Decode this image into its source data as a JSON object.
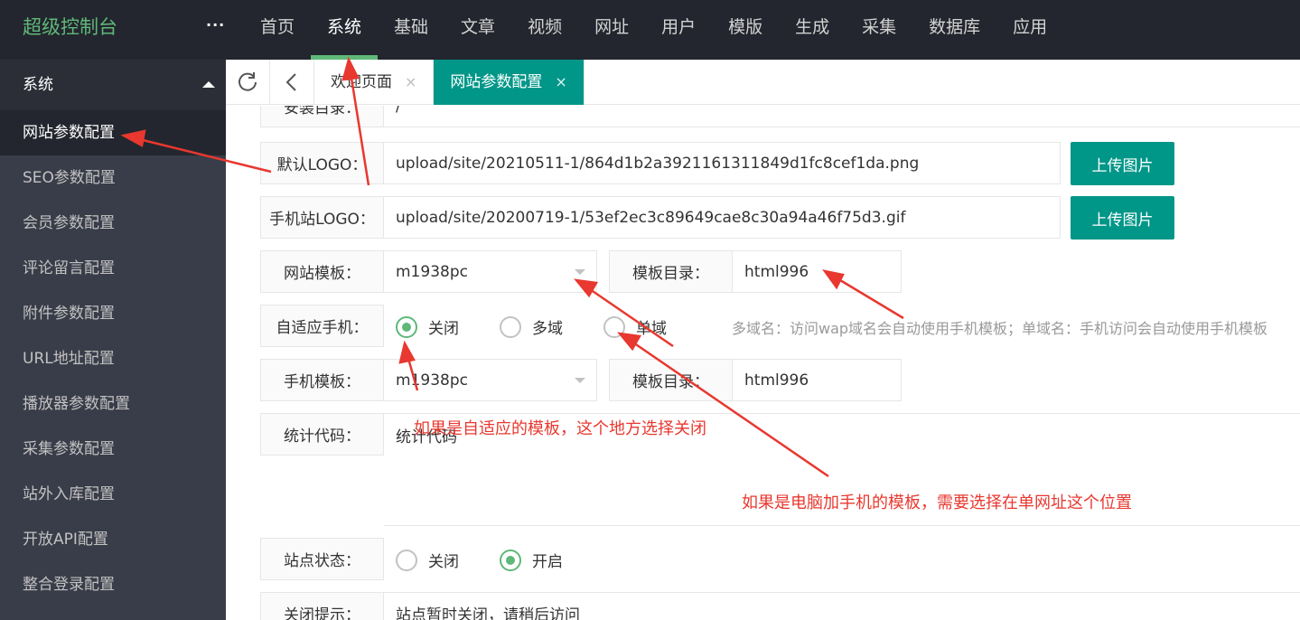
{
  "app": {
    "title": "超级控制台",
    "more_label": "···"
  },
  "nav": [
    {
      "label": "首页"
    },
    {
      "label": "系统"
    },
    {
      "label": "基础"
    },
    {
      "label": "文章"
    },
    {
      "label": "视频"
    },
    {
      "label": "网址"
    },
    {
      "label": "用户"
    },
    {
      "label": "模版"
    },
    {
      "label": "生成"
    },
    {
      "label": "采集"
    },
    {
      "label": "数据库"
    },
    {
      "label": "应用"
    }
  ],
  "sidebar": {
    "header": "系统",
    "items": [
      {
        "label": "网站参数配置"
      },
      {
        "label": "SEO参数配置"
      },
      {
        "label": "会员参数配置"
      },
      {
        "label": "评论留言配置"
      },
      {
        "label": "附件参数配置"
      },
      {
        "label": "URL地址配置"
      },
      {
        "label": "播放器参数配置"
      },
      {
        "label": "采集参数配置"
      },
      {
        "label": "站外入库配置"
      },
      {
        "label": "开放API配置"
      },
      {
        "label": "整合登录配置"
      }
    ]
  },
  "tabs": [
    {
      "label": "欢迎页面",
      "close": "×"
    },
    {
      "label": "网站参数配置",
      "close": "×"
    }
  ],
  "form": {
    "install_dir": {
      "label": "安装目录：",
      "value": "/"
    },
    "default_logo": {
      "label": "默认LOGO：",
      "value": "upload/site/20210511-1/864d1b2a3921161311849d1fc8cef1da.png",
      "button": "上传图片"
    },
    "mobile_logo": {
      "label": "手机站LOGO：",
      "value": "upload/site/20200719-1/53ef2ec3c89649cae8c30a94a46f75d3.gif",
      "button": "上传图片"
    },
    "site_template": {
      "label": "网站模板：",
      "value": "m1938pc",
      "dir_label": "模板目录：",
      "dir_value": "html996"
    },
    "adaptive": {
      "label": "自适应手机：",
      "options": [
        {
          "label": "关闭"
        },
        {
          "label": "多域"
        },
        {
          "label": "单域"
        }
      ],
      "selected": "关闭",
      "hint": "多域名：访问wap域名会自动使用手机模板；单域名：手机访问会自动使用手机模板"
    },
    "mobile_template": {
      "label": "手机模板：",
      "value": "m1938pc",
      "dir_label": "模板目录：",
      "dir_value": "html996"
    },
    "stats_code": {
      "label": "统计代码：",
      "value": "统计代码"
    },
    "site_status": {
      "label": "站点状态：",
      "options": [
        {
          "label": "关闭"
        },
        {
          "label": "开启"
        }
      ],
      "selected": "开启"
    },
    "close_tip": {
      "label": "关闭提示：",
      "value": "站点暂时关闭，请稍后访问"
    }
  },
  "annotations": {
    "note1": "如果是自适应的模板，这个地方选择关闭",
    "note2": "如果是电脑加手机的模板，需要选择在单网址这个位置"
  },
  "colors": {
    "accent": "#009688",
    "green": "#5fb878",
    "annotation": "#e8382f",
    "topbar": "#23262e",
    "sidebar": "#393d49"
  }
}
